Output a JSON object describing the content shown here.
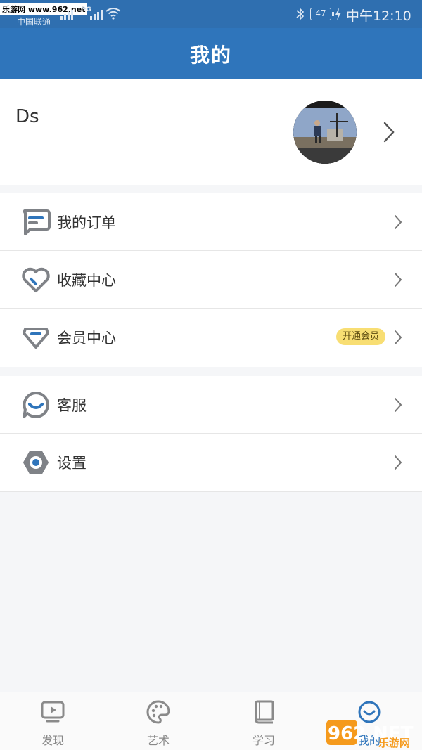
{
  "status_bar": {
    "watermark": "乐游网 www.962.net",
    "carrier": "中国联通",
    "network": "3G",
    "battery": "47",
    "time": "中午12:10"
  },
  "header": {
    "title": "我的"
  },
  "profile": {
    "username": "Ds"
  },
  "menu_group_1": [
    {
      "label": "我的订单",
      "icon": "order-icon"
    },
    {
      "label": "收藏中心",
      "icon": "heart-icon"
    },
    {
      "label": "会员中心",
      "icon": "diamond-icon",
      "badge": "开通会员"
    }
  ],
  "menu_group_2": [
    {
      "label": "客服",
      "icon": "customer-service-icon"
    },
    {
      "label": "设置",
      "icon": "settings-icon"
    }
  ],
  "tabbar": [
    {
      "label": "发现",
      "icon": "tv-icon"
    },
    {
      "label": "艺术",
      "icon": "palette-icon"
    },
    {
      "label": "学习",
      "icon": "book-icon"
    },
    {
      "label": "我的",
      "icon": "smile-icon",
      "active": true
    }
  ],
  "watermark_logo": {
    "text": "962.NET",
    "sub": "乐游网"
  },
  "colors": {
    "primary": "#2f75bb",
    "badge": "#f8de73",
    "icon_gray": "#7f8287",
    "accent_blue": "#2f75bb"
  }
}
